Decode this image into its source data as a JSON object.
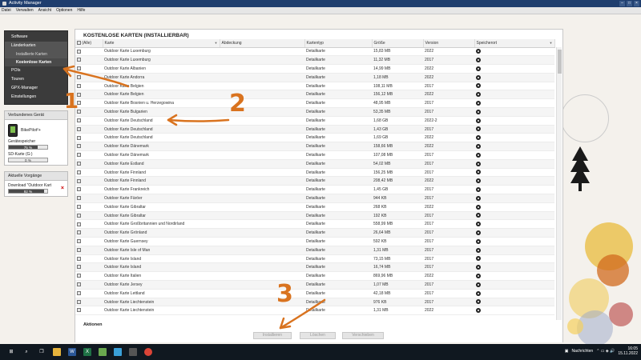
{
  "window": {
    "title": "Activity Manager"
  },
  "menu": [
    "Datei",
    "Verwalten",
    "Ansicht",
    "Optionen",
    "Hilfe"
  ],
  "sidebar": {
    "nav": [
      {
        "label": "Software",
        "type": "item"
      },
      {
        "label": "Länderkarten",
        "type": "group"
      },
      {
        "label": "Installierte Karten",
        "type": "sub"
      },
      {
        "label": "Kostenlose Karten",
        "type": "sub-active"
      },
      {
        "label": "POIs",
        "type": "item"
      },
      {
        "label": "Touren",
        "type": "item"
      },
      {
        "label": "GPX-Manager",
        "type": "item"
      },
      {
        "label": "Einstellungen",
        "type": "item"
      }
    ],
    "device_panel": {
      "title": "Verbundenes Gerät",
      "device_name": "BikePilot²+",
      "internal_label": "Gerätespeicher",
      "internal_value": "75 %",
      "internal_fraction": 0.75,
      "sd_label": "SD-Karte (G:)",
      "sd_value": "0 %",
      "sd_fraction": 0.0
    },
    "jobs_panel": {
      "title": "Aktuelle Vorgänge",
      "job_label": "Download \"Outdoor Kart",
      "job_value": "92 %",
      "job_fraction": 0.92
    }
  },
  "main": {
    "title": "KOSTENLOSE KARTEN (INSTALLIERBAR)",
    "columns": [
      "(Alle)",
      "Karte",
      "Abdeckung",
      "Kartentyp",
      "Größe",
      "Version",
      "Speicherort"
    ],
    "rows": [
      [
        "Outdoor Karte Luxemburg",
        "",
        "Detailkarte",
        "15,83 MB",
        "2022"
      ],
      [
        "Outdoor Karte Luxemburg",
        "",
        "Detailkarte",
        "11,32 MB",
        "2017"
      ],
      [
        "Outdoor Karte Albanien",
        "",
        "Detailkarte",
        "14,99 MB",
        "2022"
      ],
      [
        "Outdoor Karte Andorra",
        "",
        "Detailkarte",
        "1,18 MB",
        "2022"
      ],
      [
        "Outdoor Karte Belgien",
        "",
        "Detailkarte",
        "108,11 MB",
        "2017"
      ],
      [
        "Outdoor Karte Belgien",
        "",
        "Detailkarte",
        "156,12 MB",
        "2022"
      ],
      [
        "Outdoor Karte Bosnien u. Herzegowina",
        "",
        "Detailkarte",
        "48,95 MB",
        "2017"
      ],
      [
        "Outdoor Karte Bulgarien",
        "",
        "Detailkarte",
        "53,35 MB",
        "2017"
      ],
      [
        "Outdoor Karte Deutschland",
        "",
        "Detailkarte",
        "1,68 GB",
        "2022-2"
      ],
      [
        "Outdoor Karte Deutschland",
        "",
        "Detailkarte",
        "1,43 GB",
        "2017"
      ],
      [
        "Outdoor Karte Deutschland",
        "",
        "Detailkarte",
        "1,69 GB",
        "2022"
      ],
      [
        "Outdoor Karte Dänemark",
        "",
        "Detailkarte",
        "158,66 MB",
        "2022"
      ],
      [
        "Outdoor Karte Dänemark",
        "",
        "Detailkarte",
        "107,08 MB",
        "2017"
      ],
      [
        "Outdoor Karte Estland",
        "",
        "Detailkarte",
        "54,02 MB",
        "2017"
      ],
      [
        "Outdoor Karte Finnland",
        "",
        "Detailkarte",
        "156,25 MB",
        "2017"
      ],
      [
        "Outdoor Karte Finnland",
        "",
        "Detailkarte",
        "208,42 MB",
        "2022"
      ],
      [
        "Outdoor Karte Frankreich",
        "",
        "Detailkarte",
        "1,45 GB",
        "2017"
      ],
      [
        "Outdoor Karte Färöer",
        "",
        "Detailkarte",
        "944 KB",
        "2017"
      ],
      [
        "Outdoor Karte Gibraltar",
        "",
        "Detailkarte",
        "268 KB",
        "2022"
      ],
      [
        "Outdoor Karte Gibraltar",
        "",
        "Detailkarte",
        "192 KB",
        "2017"
      ],
      [
        "Outdoor Karte Großbritannien und Nordirland",
        "",
        "Detailkarte",
        "558,99 MB",
        "2017"
      ],
      [
        "Outdoor Karte Grönland",
        "",
        "Detailkarte",
        "26,64 MB",
        "2017"
      ],
      [
        "Outdoor Karte Guernsey",
        "",
        "Detailkarte",
        "592 KB",
        "2017"
      ],
      [
        "Outdoor Karte Isle of Man",
        "",
        "Detailkarte",
        "1,31 MB",
        "2017"
      ],
      [
        "Outdoor Karte Island",
        "",
        "Detailkarte",
        "73,15 MB",
        "2017"
      ],
      [
        "Outdoor Karte Island",
        "",
        "Detailkarte",
        "16,74 MB",
        "2017"
      ],
      [
        "Outdoor Karte Italien",
        "",
        "Detailkarte",
        "869,96 MB",
        "2022"
      ],
      [
        "Outdoor Karte Jersey",
        "",
        "Detailkarte",
        "1,07 MB",
        "2017"
      ],
      [
        "Outdoor Karte Lettland",
        "",
        "Detailkarte",
        "42,18 MB",
        "2017"
      ],
      [
        "Outdoor Karte Liechtenstein",
        "",
        "Detailkarte",
        "976 KB",
        "2017"
      ],
      [
        "Outdoor Karte Liechtenstein",
        "",
        "Detailkarte",
        "1,31 MB",
        "2022"
      ]
    ],
    "actions": {
      "title": "Aktionen",
      "install_label": "Installieren",
      "delete_label": "Löschen",
      "move_label": "Verschieben"
    }
  },
  "annotations": {
    "one": "1",
    "two": "2",
    "three": "3",
    "color": "#d9731f"
  },
  "taskbar": {
    "notifications_label": "Nachrichten",
    "time": "16:05",
    "date": "15.11.2022"
  }
}
